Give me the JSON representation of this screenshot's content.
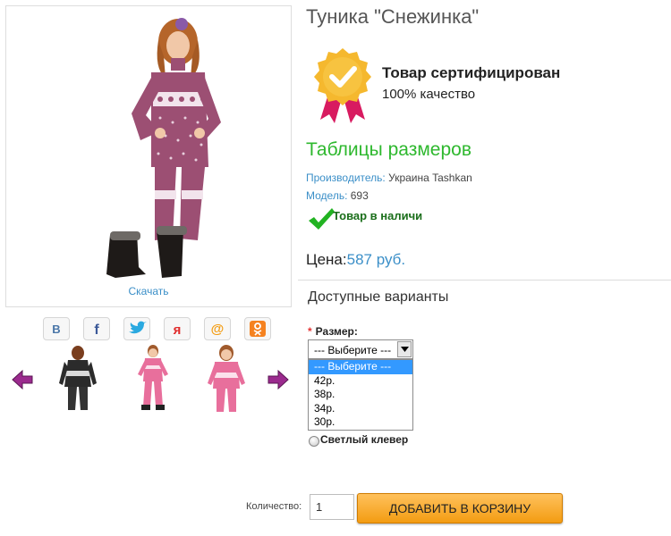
{
  "product": {
    "title": "Туника \"Снежинка\"",
    "download_label": "Скачать",
    "cert_title": "Товар сертифицирован",
    "cert_subtitle": "100% качество",
    "size_table_link": "Таблицы размеров",
    "manufacturer_key": "Производитель:",
    "manufacturer_value": "Украина Tashkan",
    "model_key": "Модель:",
    "model_value": "693",
    "stock_status": "Товар в наличи",
    "price_label": "Цена:",
    "price_value": "587 руб."
  },
  "share": {
    "buttons": [
      "vk-icon",
      "facebook-icon",
      "twitter-icon",
      "odnoklassniki-icon",
      "mail-icon",
      "ok-icon"
    ]
  },
  "options": {
    "title": "Доступные варианты",
    "size_label": "Размер:",
    "required_mark": "*",
    "selected": "--- Выберите ---",
    "items": [
      "--- Выберите ---",
      "42р.",
      "38р.",
      "34р.",
      "30р."
    ],
    "color_label": "Светлый клевер"
  },
  "cart": {
    "qty_label": "Количество:",
    "qty_value": "1",
    "add_label": "ДОБАВИТЬ В КОРЗИНУ"
  },
  "colors": {
    "accent_blue": "#3b8fc8",
    "green": "#2eb82e",
    "orange": "#f39c12",
    "tunic": "#9c4f73"
  }
}
